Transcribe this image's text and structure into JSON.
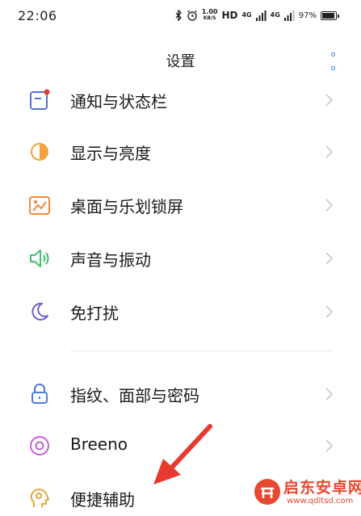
{
  "status_bar": {
    "time": "22:06",
    "net_speed_value": "1.00",
    "net_speed_unit": "KB/S",
    "hd_label": "HD",
    "signal1_label": "4G",
    "signal2_label": "4G",
    "battery_percent": "97%"
  },
  "header": {
    "title": "设置"
  },
  "items": [
    {
      "label": "通知与状态栏",
      "icon": "notification-icon"
    },
    {
      "label": "显示与亮度",
      "icon": "brightness-icon"
    },
    {
      "label": "桌面与乐划锁屏",
      "icon": "wallpaper-icon"
    },
    {
      "label": "声音与振动",
      "icon": "speaker-icon"
    },
    {
      "label": "免打扰",
      "icon": "moon-icon"
    },
    {
      "label": "指纹、面部与密码",
      "icon": "lock-icon"
    },
    {
      "label": "Breeno",
      "icon": "breeno-icon"
    },
    {
      "label": "便捷辅助",
      "icon": "accessibility-icon"
    }
  ],
  "watermark": {
    "title": "启东安卓网",
    "url": "www.qdltsd.com"
  },
  "colors": {
    "accent_blue": "#2f86e8",
    "annotation_red": "#e8392f"
  }
}
